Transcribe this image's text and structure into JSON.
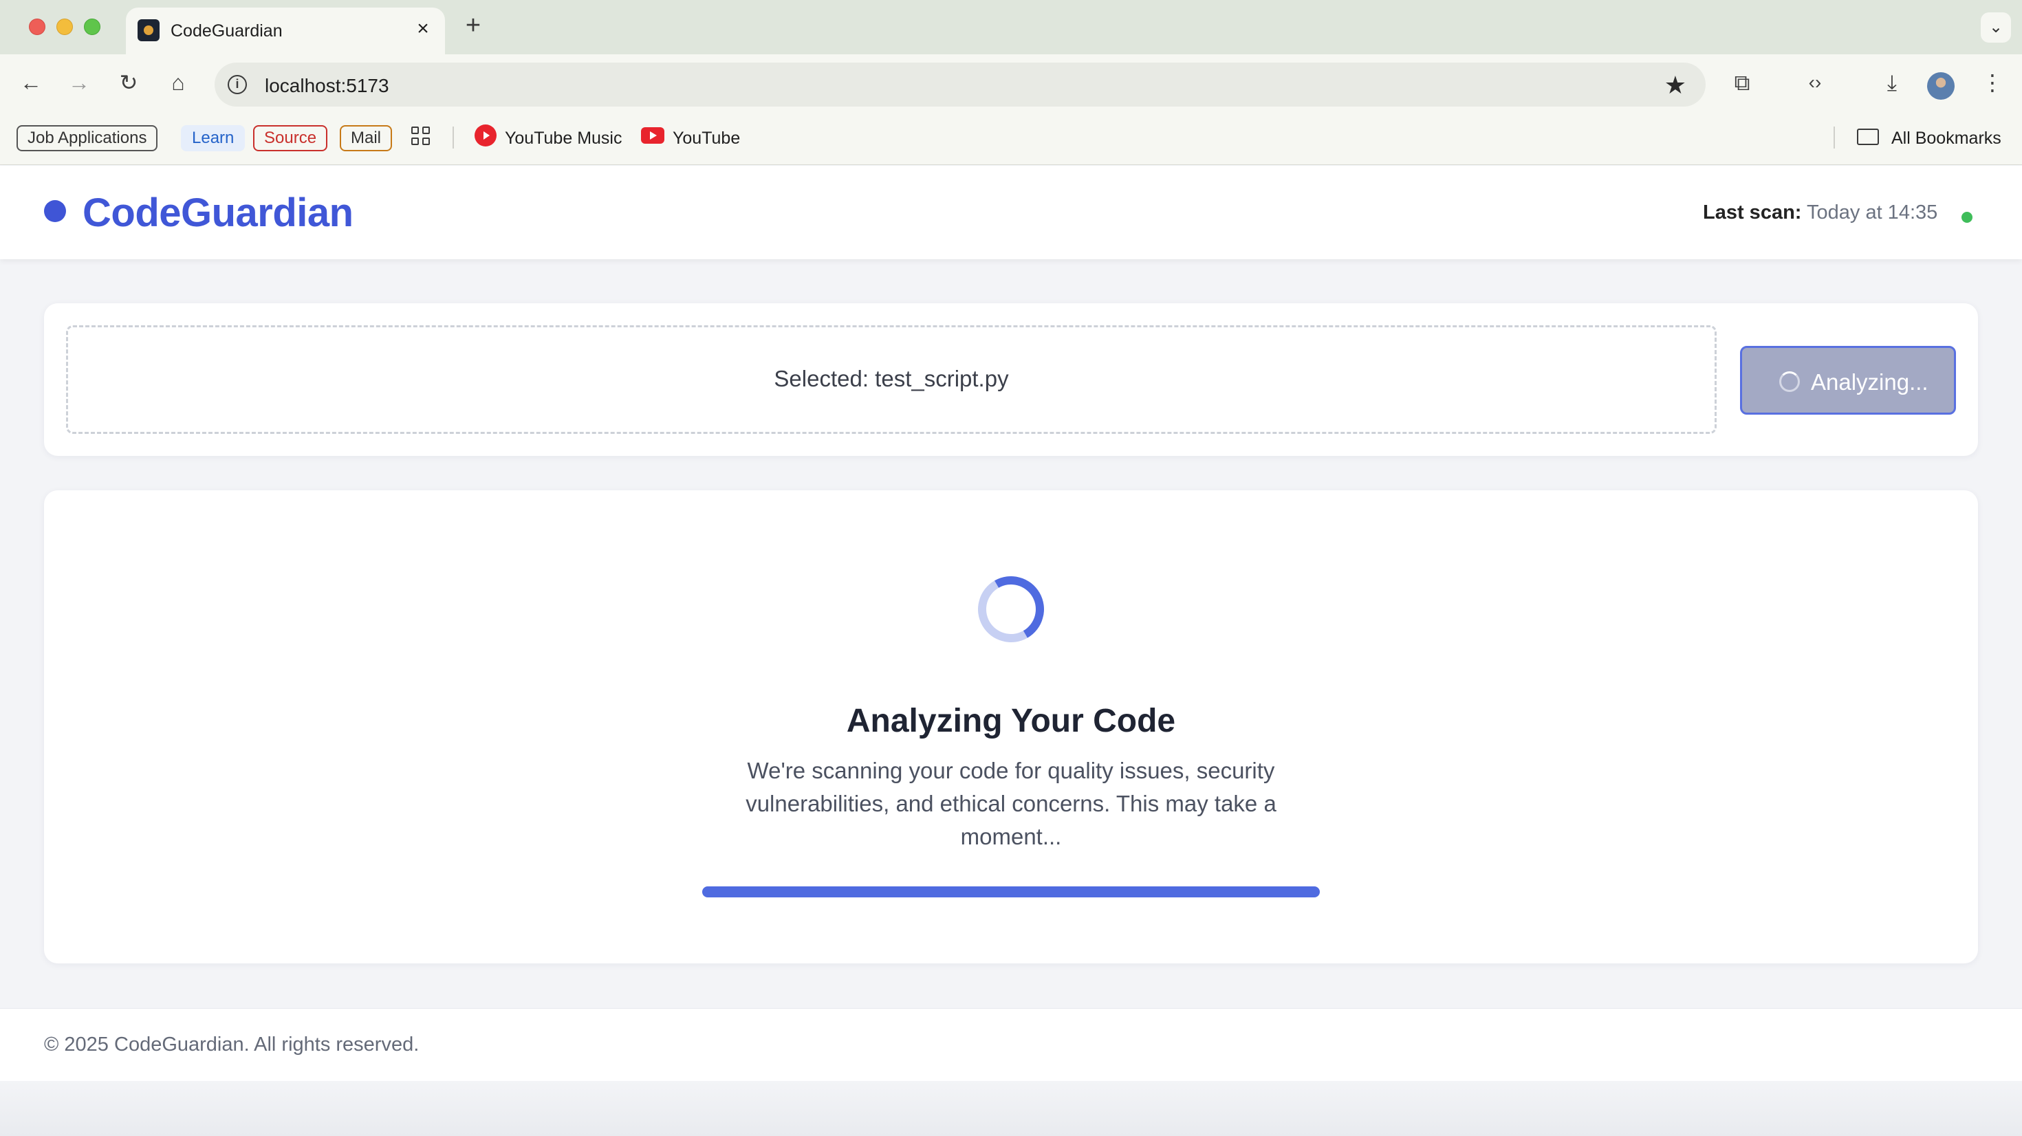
{
  "browser": {
    "tab_title": "CodeGuardian",
    "url": "localhost:5173",
    "bookmarks": {
      "job_applications": "Job Applications",
      "learn": "Learn",
      "source": "Source",
      "mail": "Mail",
      "youtube_music": "YouTube Music",
      "youtube": "YouTube",
      "all_bookmarks": "All Bookmarks"
    },
    "icons": [
      "back-icon",
      "forward-icon",
      "reload-icon",
      "home-icon",
      "info-icon",
      "star-icon",
      "extensions-icon",
      "code-icon",
      "download-icon",
      "menu-icon"
    ]
  },
  "header": {
    "brand": "CodeGuardian",
    "last_scan_label": "Last scan:",
    "last_scan_value": "Today at 14:35",
    "status_color": "#3fbd5a"
  },
  "upload": {
    "selected_text": "Selected: test_script.py",
    "button_label": "Analyzing..."
  },
  "analysis": {
    "title": "Analyzing Your Code",
    "description": "We're scanning your code for quality issues, security vulnerabilities, and ethical concerns. This may take a moment...",
    "progress": 1.0
  },
  "footer": {
    "text": "© 2025 CodeGuardian. All rights reserved."
  },
  "colors": {
    "accent": "#4057d7",
    "progress": "#4f6be0"
  }
}
